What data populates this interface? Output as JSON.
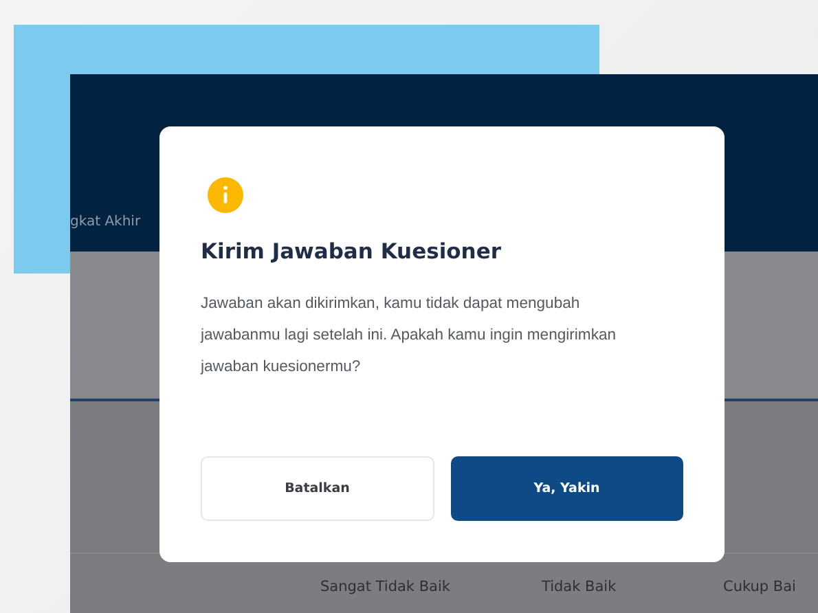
{
  "app": {
    "header_text": "gkat Akhir",
    "table_columns": [
      "Sangat Tidak Baik",
      "Tidak Baik",
      "Cukup Bai"
    ]
  },
  "dialog": {
    "title": "Kirim Jawaban Kuesioner",
    "message": "Jawaban akan dikirimkan, kamu tidak dapat mengubah jawabanmu lagi setelah ini. Apakah kamu ingin mengirimkan jawaban kuesionermu?",
    "buttons": [
      {
        "label": "Batalkan",
        "kind": "secondary"
      },
      {
        "label": "Ya, Yakin",
        "kind": "primary"
      }
    ]
  }
}
